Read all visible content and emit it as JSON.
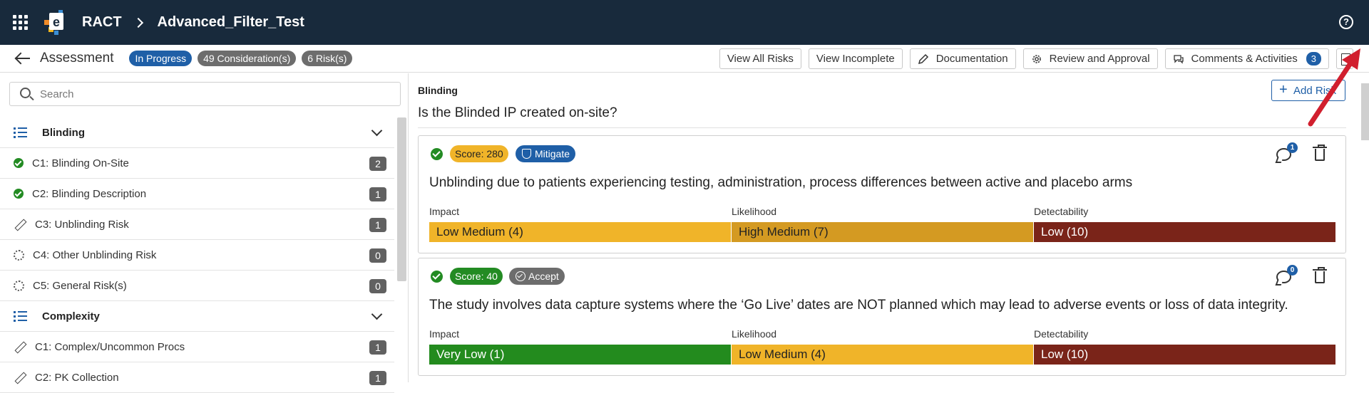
{
  "topbar": {
    "app_name": "RACT",
    "project": "Advanced_Filter_Test",
    "help_symbol": "?"
  },
  "subbar": {
    "title": "Assessment",
    "status": "In Progress",
    "considerations": "49 Consideration(s)",
    "risks": "6 Risk(s)",
    "buttons": {
      "view_all": "View All Risks",
      "view_incomplete": "View Incomplete",
      "documentation": "Documentation",
      "review": "Review and Approval",
      "comments": "Comments & Activities",
      "comments_count": "3"
    }
  },
  "sidebar": {
    "search_placeholder": "Search",
    "sections": [
      {
        "label": "Blinding",
        "items": [
          {
            "label": "C1: Blinding On-Site",
            "count": "2",
            "state": "complete"
          },
          {
            "label": "C2: Blinding Description",
            "count": "1",
            "state": "complete"
          },
          {
            "label": "C3: Unblinding Risk",
            "count": "1",
            "state": "editing"
          },
          {
            "label": "C4: Other Unblinding Risk",
            "count": "0",
            "state": "empty"
          },
          {
            "label": "C5: General Risk(s)",
            "count": "0",
            "state": "empty"
          }
        ]
      },
      {
        "label": "Complexity",
        "items": [
          {
            "label": "C1: Complex/Uncommon Procs",
            "count": "1",
            "state": "editing"
          },
          {
            "label": "C2: PK Collection",
            "count": "1",
            "state": "editing"
          }
        ]
      }
    ]
  },
  "main": {
    "section_label": "Blinding",
    "question": "Is the Blinded IP created on-site?",
    "add_risk": "Add Risk",
    "factor_labels": [
      "Impact",
      "Likelihood",
      "Detectability"
    ],
    "risks": [
      {
        "score": "Score: 280",
        "score_color": "#f0b429",
        "action": "Mitigate",
        "action_color": "#1f5fa7",
        "comments": "1",
        "text": "Unblinding due to patients experiencing testing, administration, process differences between active and placebo arms",
        "factors": [
          {
            "value": "Low Medium (4)",
            "color": "#f0b429",
            "text_color": "#222"
          },
          {
            "value": "High Medium (7)",
            "color": "#d49a22",
            "text_color": "#222"
          },
          {
            "value": "Low (10)",
            "color": "#7a2419",
            "text_color": "#fff"
          }
        ]
      },
      {
        "score": "Score: 40",
        "score_color": "#238b23",
        "action": "Accept",
        "action_color": "#6d6d6d",
        "comments": "0",
        "text": "The study involves data capture systems where the ‘Go Live’ dates are NOT planned which may lead to adverse events or loss of data integrity.",
        "factors": [
          {
            "value": "Very Low (1)",
            "color": "#238b1e",
            "text_color": "#fff"
          },
          {
            "value": "Low Medium (4)",
            "color": "#f0b429",
            "text_color": "#222"
          },
          {
            "value": "Low (10)",
            "color": "#7a2419",
            "text_color": "#fff"
          }
        ]
      }
    ]
  },
  "colors": {
    "topbar": "#182a3c",
    "accent": "#1f5fa7",
    "annotation_arrow": "#d11f2e"
  }
}
